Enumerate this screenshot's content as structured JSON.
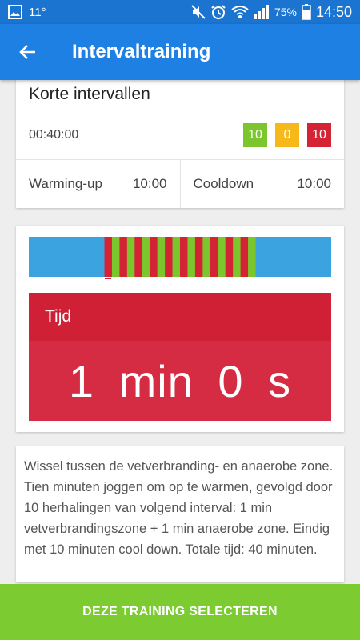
{
  "status": {
    "temperature": "11°",
    "battery": "75%",
    "time": "14:50"
  },
  "appbar": {
    "title": "Intervaltraining"
  },
  "training": {
    "name": "Korte intervallen",
    "duration": "00:40:00",
    "badges": [
      {
        "value": "10",
        "color": "#7cc62d"
      },
      {
        "value": "0",
        "color": "#f7b819"
      },
      {
        "value": "10",
        "color": "#d52336"
      }
    ],
    "warmup_label": "Warming-up",
    "warmup_value": "10:00",
    "cooldown_label": "Cooldown",
    "cooldown_value": "10:00"
  },
  "timeline": {
    "colors": {
      "warm": "#3aa3e0",
      "green": "#7cc62d",
      "red": "#d52336"
    },
    "warmup_minutes": 10,
    "interval_minutes": 20,
    "cooldown_minutes": 10,
    "segment_order": [
      "red",
      "green"
    ]
  },
  "current": {
    "label": "Tijd",
    "value": "1 min 0 s"
  },
  "description": "Wissel tussen de vetverbranding- en anaerobe zone. Tien minuten joggen om op te warmen, gevolgd door 10 herhalingen van volgend interval: 1 min vetverbrandingszone + 1 min anaerobe zone. Eindig met 10 minuten cool down. Totale tijd: 40 minuten.",
  "cta_label": "DEZE TRAINING SELECTEREN"
}
